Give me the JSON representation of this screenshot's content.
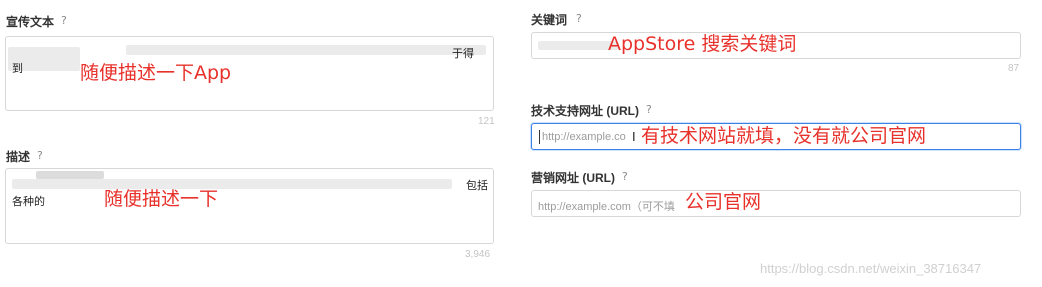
{
  "left": {
    "promo": {
      "label": "宣传文本",
      "help": "?",
      "text_start": "到",
      "text_end": "于得",
      "counter": "121",
      "annotation": "随便描述一下App"
    },
    "desc": {
      "label": "描述",
      "help": "?",
      "text_start": "各种的",
      "text_end": "包括",
      "counter": "3,946",
      "annotation": "随便描述一下"
    }
  },
  "right": {
    "keywords": {
      "label": "关键词",
      "help": "?",
      "counter": "87",
      "annotation": "AppStore 搜索关键词"
    },
    "support_url": {
      "label": "技术支持网址 (URL)",
      "help": "?",
      "placeholder": "http://example.co",
      "annotation": "有技术网站就填，没有就公司官网"
    },
    "marketing_url": {
      "label": "营销网址 (URL)",
      "help": "?",
      "placeholder": "http://example.com（可不填",
      "annotation": "公司官网"
    }
  },
  "watermark": "https://blog.csdn.net/weixin_38716347",
  "icons": {
    "help": "question-mark-icon",
    "cursor": "text-cursor-icon"
  },
  "colors": {
    "annotation": "#e8312b",
    "focus_border": "#3b82e6",
    "border": "#d7d7d7"
  }
}
